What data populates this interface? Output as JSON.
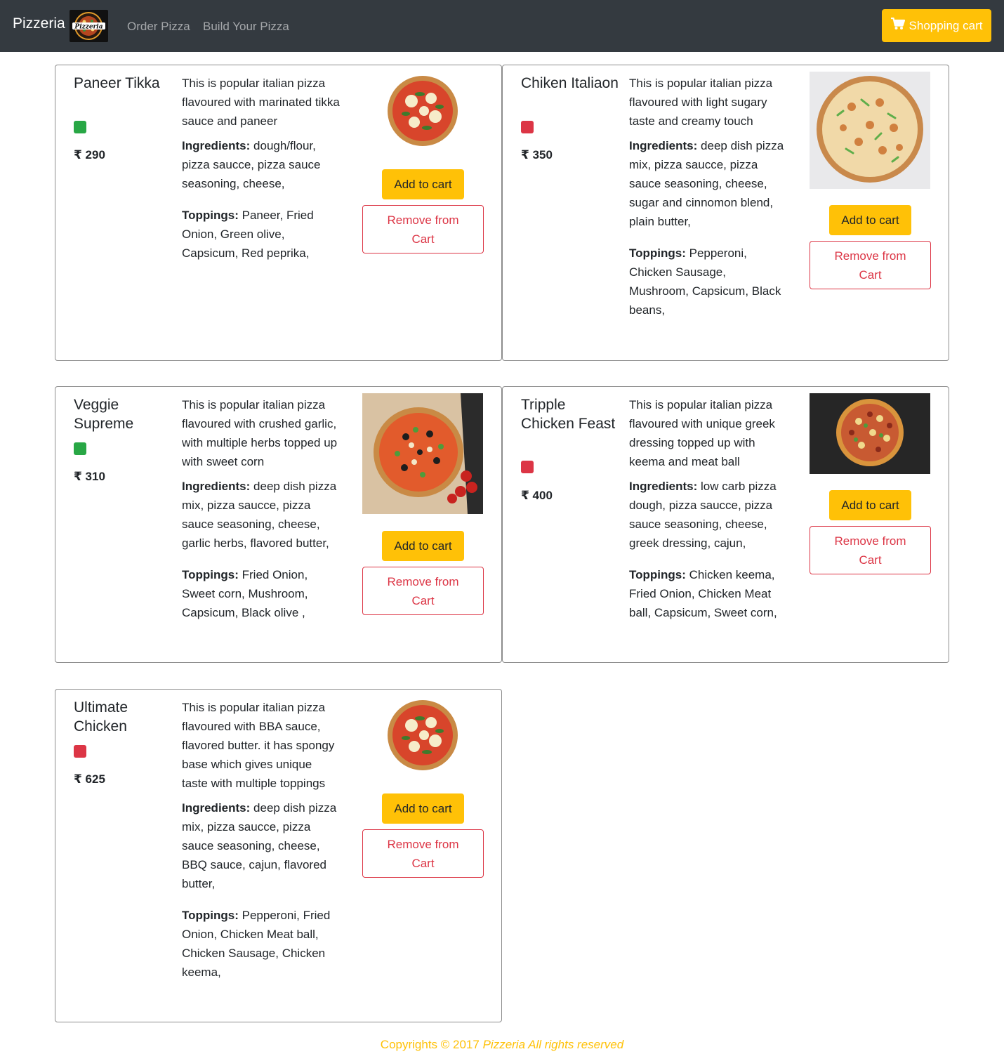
{
  "navbar": {
    "brand": "Pizzeria",
    "logo_text": "Pizzeria",
    "links": [
      "Order Pizza",
      "Build Your Pizza"
    ],
    "cart_label": "Shopping cart",
    "cart_icon": "shopping-cart-icon"
  },
  "labels": {
    "ingredients": "Ingredients:",
    "toppings": "Toppings:",
    "add_to_cart": "Add to cart",
    "remove_from_cart": "Remove from Cart",
    "currency": "₹"
  },
  "products": [
    {
      "name": "Paneer Tikka",
      "veg": true,
      "price": "₹ 290",
      "description": "This is popular italian pizza flavoured with marinated tikka sauce and paneer",
      "ingredients": "dough/flour, pizza saucce, pizza sauce seasoning, cheese,",
      "toppings": "Paneer, Fried Onion, Green olive, Capsicum, Red peprika,"
    },
    {
      "name": "Chiken Italiaon",
      "veg": false,
      "price": "₹ 350",
      "description": "This is popular italian pizza flavoured with light sugary taste and creamy touch",
      "ingredients": "deep dish pizza mix, pizza saucce, pizza sauce seasoning, cheese, sugar and cinnomon blend, plain butter,",
      "toppings": "Pepperoni, Chicken Sausage, Mushroom, Capsicum, Black beans,"
    },
    {
      "name": "Veggie Supreme",
      "veg": true,
      "price": "₹ 310",
      "description": "This is popular italian pizza flavoured with crushed garlic, with multiple herbs topped up with sweet corn",
      "ingredients": "deep dish pizza mix, pizza saucce, pizza sauce seasoning, cheese, garlic herbs, flavored butter,",
      "toppings": "Fried Onion, Sweet corn, Mushroom, Capsicum, Black olive ,"
    },
    {
      "name": "Tripple Chicken Feast",
      "veg": false,
      "price": "₹ 400",
      "description": "This is popular italian pizza flavoured with unique greek dressing topped up with keema and meat ball",
      "ingredients": "low carb pizza dough, pizza saucce, pizza sauce seasoning, cheese, greek dressing, cajun,",
      "toppings": "Chicken keema, Fried Onion, Chicken Meat ball, Capsicum, Sweet corn,"
    },
    {
      "name": "Ultimate Chicken",
      "veg": false,
      "price": "₹ 625",
      "description": "This is popular italian pizza flavoured with BBA sauce, flavored butter. it has spongy base which gives unique taste with multiple toppings",
      "ingredients": "deep dish pizza mix, pizza saucce, pizza sauce seasoning, cheese, BBQ sauce, cajun, flavored butter,",
      "toppings": "Pepperoni, Fried Onion, Chicken Meat ball, Chicken Sausage, Chicken keema,"
    }
  ],
  "footer": {
    "prefix": "Copyrights © 2017 ",
    "suffix": "Pizzeria All rights reserved"
  },
  "colors": {
    "navbar_bg": "#343a40",
    "accent": "#ffc107",
    "veg": "#28a745",
    "nonveg": "#dc3545"
  }
}
